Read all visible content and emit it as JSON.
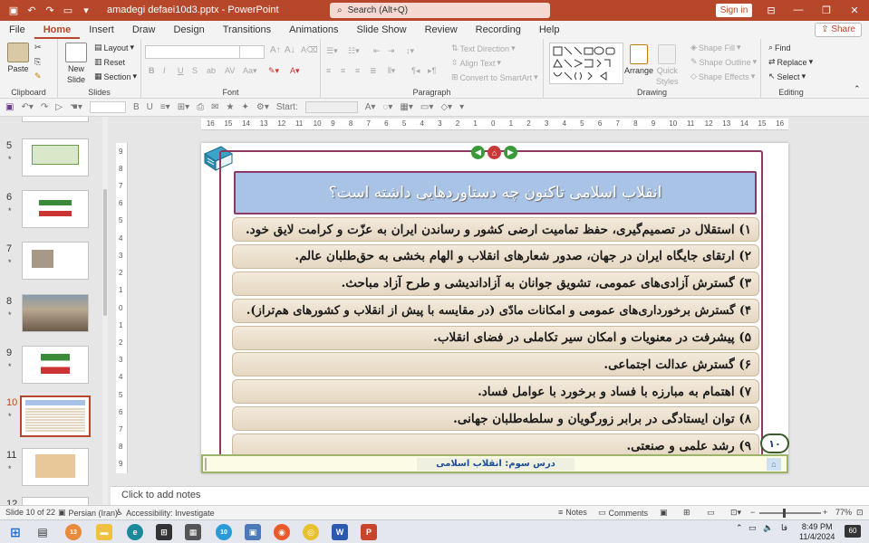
{
  "window": {
    "doc_title": "amadegi defaei10d3.pptx - PowerPoint",
    "search_placeholder": "Search (Alt+Q)",
    "signin_label": "Sign in"
  },
  "tabs": [
    "File",
    "Home",
    "Insert",
    "Draw",
    "Design",
    "Transitions",
    "Animations",
    "Slide Show",
    "Review",
    "Recording",
    "Help"
  ],
  "share_label": "Share",
  "ribbon": {
    "clipboard": {
      "paste": "Paste",
      "label": "Clipboard"
    },
    "slides": {
      "new_slide_line1": "New",
      "new_slide_line2": "Slide",
      "layout": "Layout",
      "reset": "Reset",
      "section": "Section",
      "label": "Slides"
    },
    "font": {
      "label": "Font"
    },
    "paragraph": {
      "text_direction": "Text Direction",
      "align_text": "Align Text",
      "convert_smartart": "Convert to SmartArt",
      "label": "Paragraph"
    },
    "drawing": {
      "arrange": "Arrange",
      "quick_styles_line1": "Quick",
      "quick_styles_line2": "Styles",
      "shape_fill": "Shape Fill",
      "shape_outline": "Shape Outline",
      "shape_effects": "Shape Effects",
      "label": "Drawing"
    },
    "editing": {
      "find": "Find",
      "replace": "Replace",
      "select": "Select",
      "label": "Editing"
    }
  },
  "qat": {
    "start_label": "Start:"
  },
  "ruler_h": [
    "16",
    "15",
    "14",
    "13",
    "12",
    "11",
    "10",
    "9",
    "8",
    "7",
    "6",
    "5",
    "4",
    "3",
    "2",
    "1",
    "0",
    "1",
    "2",
    "3",
    "4",
    "5",
    "6",
    "7",
    "8",
    "9",
    "10",
    "11",
    "12",
    "13",
    "14",
    "15",
    "16"
  ],
  "ruler_v": [
    "9",
    "8",
    "7",
    "6",
    "5",
    "4",
    "3",
    "2",
    "1",
    "0",
    "1",
    "2",
    "3",
    "4",
    "5",
    "6",
    "7",
    "8",
    "9"
  ],
  "thumbnails": [
    {
      "num": "5",
      "star": "*"
    },
    {
      "num": "6",
      "star": "*"
    },
    {
      "num": "7",
      "star": "*"
    },
    {
      "num": "8",
      "star": "*"
    },
    {
      "num": "9",
      "star": "*"
    },
    {
      "num": "10",
      "star": "*"
    },
    {
      "num": "11",
      "star": "*"
    },
    {
      "num": "12",
      "star": ""
    }
  ],
  "slide": {
    "headline": "انقلاب اسلامی تاکنون چه دستاوردهایی داشته است؟",
    "items": [
      "۱) استقلال در تصمیم‌گیری، حفظ تمامیت ارضی کشور و رساندن ایران به عزّت و کرامت لایق خود.",
      "۲) ارتقای جایگاه ایران در جهان، صدور شعارهای انقلاب و الهام بخشی به حق‌طلبان عالم.",
      "۳) گسترش آزادی‌های عمومی، تشویق جوانان به آزاداندیشی و طرح آزاد مباحث.",
      "۴) گسترش برخورداری‌های عمومی و امکانات مادّی (در مقایسه با پیش از انقلاب و کشورهای هم‌تراز).",
      "۵) پیشرفت در معنویات و امکان سیر تکاملی در فضای انقلاب.",
      "۶) گسترش عدالت اجتماعی.",
      "۷) اهتمام به مبارزه با فساد و برخورد با عوامل فساد.",
      "۸) توان ایستادگی در برابر زورگویان و سلطه‌طلبان جهانی.",
      "۹) رشد علمی و صنعتی."
    ],
    "page_number": "۱۰",
    "footer_label": "درس سوم: انقلاب اسلامی"
  },
  "notes_placeholder": "Click to add notes",
  "status": {
    "slide_info": "Slide 10 of 22",
    "language": "Persian (Iran)",
    "accessibility": "Accessibility: Investigate",
    "notes": "Notes",
    "comments": "Comments",
    "zoom": "77%"
  },
  "taskbar": {
    "time": "8:49 PM",
    "date": "11/4/2024",
    "lang": "فا",
    "notif_count": "60",
    "badge_1": "13",
    "badge_2": "10"
  },
  "colors": {
    "accent": "#b7472a",
    "slide_frame": "#8c3a63",
    "headline_bg": "#a8c3e6",
    "footer_text": "#1a4d9a"
  }
}
